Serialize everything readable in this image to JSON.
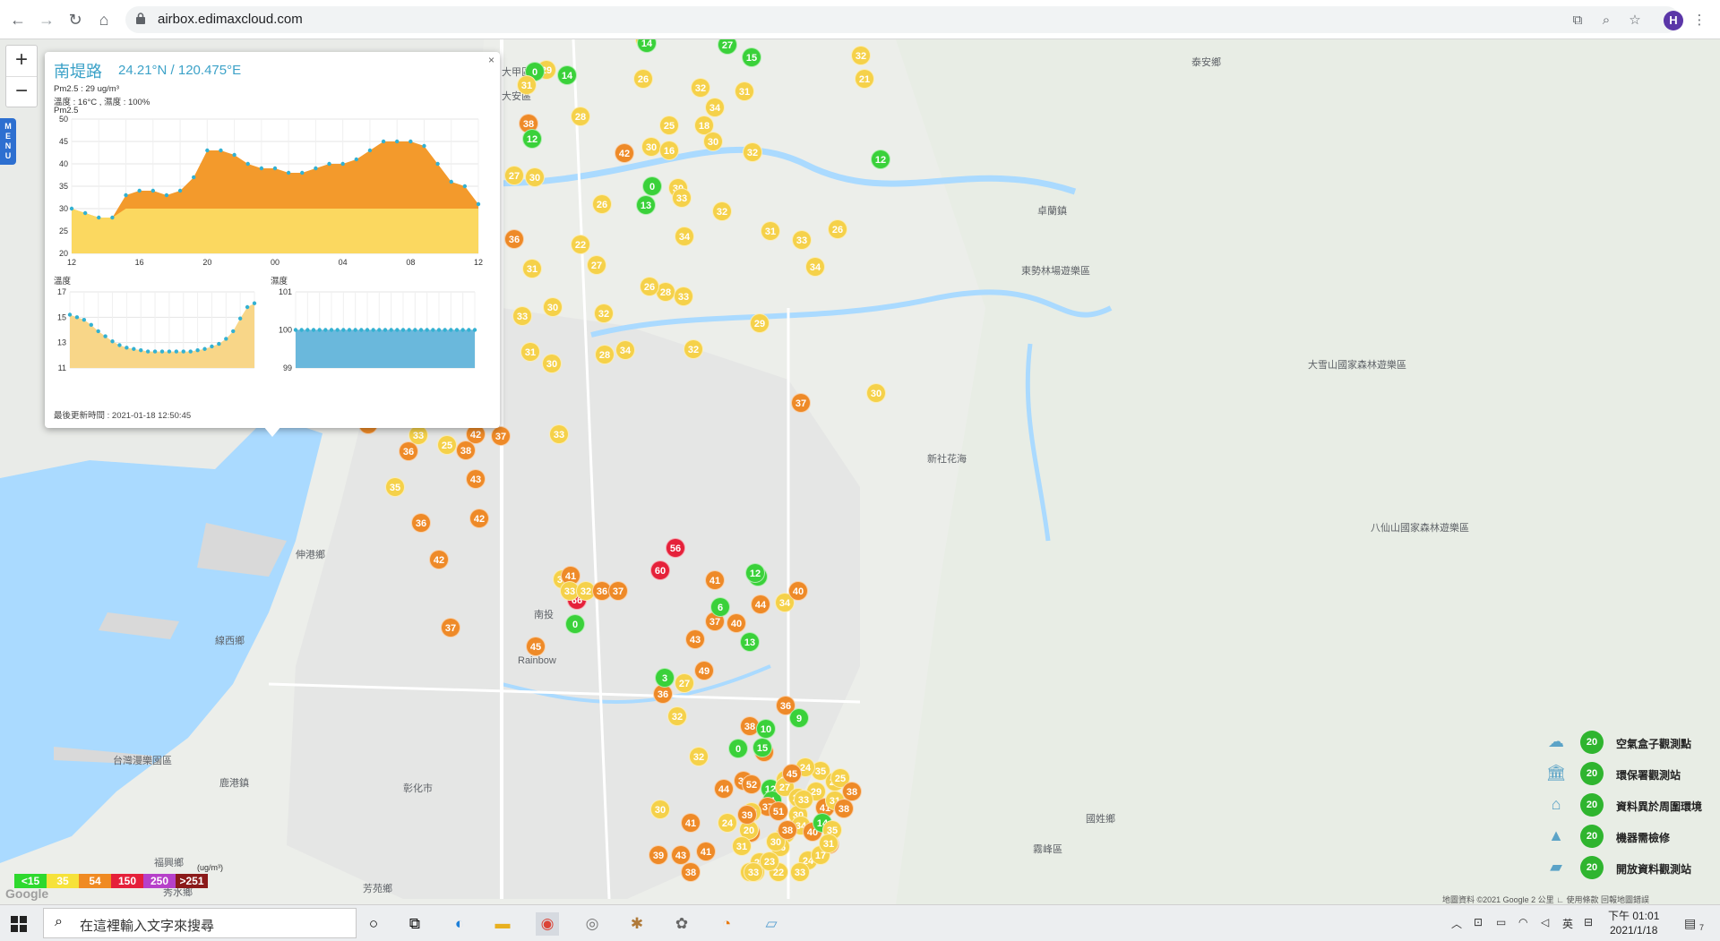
{
  "browser": {
    "url": "airbox.edimaxcloud.com",
    "profile_initial": "H"
  },
  "popup": {
    "close": "×",
    "title": "南堤路",
    "coords": "24.21°N / 120.475°E",
    "pm25_line": "Pm2.5 : 29 ug/m³",
    "temp_humidity_line": "溫度 : 16°C , 濕度 : 100%",
    "chart_title": "Pm2.5",
    "temp_title": "溫度",
    "humidity_title": "濕度",
    "last_update": "最後更新時間 : 2021-01-18 12:50:45"
  },
  "chart_data": [
    {
      "type": "area",
      "title": "Pm2.5",
      "x_ticks": [
        "12",
        "16",
        "20",
        "00",
        "04",
        "08",
        "12"
      ],
      "ylim": [
        20,
        50
      ],
      "y_ticks": [
        20,
        25,
        30,
        35,
        40,
        45,
        50
      ],
      "values": [
        30,
        29,
        28,
        28,
        33,
        34,
        34,
        33,
        34,
        37,
        43,
        43,
        42,
        40,
        39,
        39,
        38,
        38,
        39,
        40,
        40,
        41,
        43,
        45,
        45,
        45,
        44,
        40,
        36,
        35,
        31
      ]
    },
    {
      "type": "area",
      "title": "溫度",
      "ylim": [
        11,
        17
      ],
      "y_ticks": [
        11,
        13,
        15,
        17
      ],
      "values": [
        15.2,
        15,
        14.8,
        14.4,
        13.9,
        13.5,
        13.1,
        12.8,
        12.6,
        12.5,
        12.4,
        12.3,
        12.3,
        12.3,
        12.3,
        12.3,
        12.3,
        12.3,
        12.4,
        12.5,
        12.7,
        12.9,
        13.3,
        13.9,
        14.9,
        15.8,
        16.1
      ]
    },
    {
      "type": "area",
      "title": "濕度",
      "ylim": [
        99,
        101
      ],
      "y_ticks": [
        99,
        100,
        101
      ],
      "values": [
        100,
        100,
        100,
        100,
        100,
        100,
        100,
        100,
        100,
        100,
        100,
        100,
        100,
        100,
        100,
        100,
        100,
        100,
        100,
        100,
        100,
        100,
        100,
        100,
        100,
        100,
        100,
        100,
        100,
        100,
        100
      ]
    }
  ],
  "zoom": {
    "in": "+",
    "out": "−"
  },
  "menu_tab": "MENU",
  "aqi_legend": [
    {
      "label": "<15",
      "color": "#2ed92e"
    },
    {
      "label": "35",
      "color": "#f6e23a"
    },
    {
      "label": "54",
      "color": "#f08a22"
    },
    {
      "label": "150",
      "color": "#e5203a"
    },
    {
      "label": "250",
      "color": "#b640c9"
    },
    {
      "label": ">251",
      "color": "#8b1a1a"
    }
  ],
  "aqi_unit": "(ug/m³)",
  "type_legend": [
    {
      "icon": "cloud-box-icon",
      "badge": "20",
      "label": "空氣盒子觀測點"
    },
    {
      "icon": "government-building-icon",
      "badge": "20",
      "label": "環保署觀測站"
    },
    {
      "icon": "house-warning-icon",
      "badge": "20",
      "label": "資料異於周圍環境"
    },
    {
      "icon": "traffic-cone-icon",
      "badge": "20",
      "label": "機器需檢修"
    },
    {
      "icon": "open-data-icon",
      "badge": "20",
      "label": "開放資料觀測站"
    }
  ],
  "map_labels": [
    {
      "text": "大甲區"
    },
    {
      "text": "大安區"
    },
    {
      "text": "東勢林場遊樂區"
    },
    {
      "text": "大雪山國家森林遊樂區"
    },
    {
      "text": "卓蘭鎮"
    },
    {
      "text": "泰安鄉"
    },
    {
      "text": "伸港鄉"
    },
    {
      "text": "線西鄉"
    },
    {
      "text": "鹿港鎮"
    },
    {
      "text": "彰化市"
    },
    {
      "text": "福興鄉"
    },
    {
      "text": "秀水鄉"
    },
    {
      "text": "芳苑鄉"
    },
    {
      "text": "南投"
    },
    {
      "text": "霧峰區"
    },
    {
      "text": "八仙山國家森林遊樂區"
    },
    {
      "text": "國姓鄉"
    },
    {
      "text": "台灣漫樂園區"
    },
    {
      "text": "新社花海"
    },
    {
      "text": "Rainbow"
    }
  ],
  "markers": [
    {
      "v": "30",
      "c": "y"
    },
    {
      "v": "27",
      "c": "g"
    },
    {
      "v": "32",
      "c": "y"
    },
    {
      "v": "21",
      "c": "y"
    },
    {
      "v": "14",
      "c": "g"
    },
    {
      "v": "15",
      "c": "g"
    },
    {
      "v": "29",
      "c": "y"
    },
    {
      "v": "26",
      "c": "y"
    },
    {
      "v": "32",
      "c": "y"
    },
    {
      "v": "0",
      "c": "g"
    },
    {
      "v": "14",
      "c": "g"
    },
    {
      "v": "14",
      "c": "g"
    },
    {
      "v": "31",
      "c": "y"
    },
    {
      "v": "38",
      "c": "o"
    },
    {
      "v": "28",
      "c": "y"
    },
    {
      "v": "25",
      "c": "y"
    },
    {
      "v": "34",
      "c": "y"
    },
    {
      "v": "32",
      "c": "y"
    },
    {
      "v": "13",
      "c": "g"
    },
    {
      "v": "18",
      "c": "y"
    },
    {
      "v": "42",
      "c": "o"
    },
    {
      "v": "30",
      "c": "y"
    },
    {
      "v": "12",
      "c": "g"
    },
    {
      "v": "14",
      "c": "g"
    },
    {
      "v": "12",
      "c": "g"
    },
    {
      "v": "16",
      "c": "y"
    },
    {
      "v": "31",
      "c": "y"
    },
    {
      "v": "27",
      "c": "y"
    },
    {
      "v": "30",
      "c": "y"
    },
    {
      "v": "0",
      "c": "g"
    },
    {
      "v": "30",
      "c": "y"
    },
    {
      "v": "26",
      "c": "y"
    },
    {
      "v": "30",
      "c": "y"
    },
    {
      "v": "30",
      "c": "y"
    },
    {
      "v": "13",
      "c": "g"
    },
    {
      "v": "33",
      "c": "y"
    },
    {
      "v": "16",
      "c": "y"
    },
    {
      "v": "36",
      "c": "o"
    },
    {
      "v": "22",
      "c": "y"
    },
    {
      "v": "32",
      "c": "y"
    },
    {
      "v": "31",
      "c": "y"
    },
    {
      "v": "26",
      "c": "y"
    },
    {
      "v": "34",
      "c": "y"
    },
    {
      "v": "33",
      "c": "y"
    },
    {
      "v": "31",
      "c": "y"
    },
    {
      "v": "27",
      "c": "y"
    },
    {
      "v": "34",
      "c": "y"
    },
    {
      "v": "28",
      "c": "y"
    },
    {
      "v": "29",
      "c": "y"
    },
    {
      "v": "30",
      "c": "y"
    },
    {
      "v": "32",
      "c": "y"
    },
    {
      "v": "26",
      "c": "y"
    },
    {
      "v": "33",
      "c": "y"
    },
    {
      "v": "28",
      "c": "y"
    },
    {
      "v": "31",
      "c": "y"
    },
    {
      "v": "33",
      "c": "y"
    },
    {
      "v": "32",
      "c": "y"
    },
    {
      "v": "30",
      "c": "y"
    },
    {
      "v": "34",
      "c": "y"
    },
    {
      "v": "30",
      "c": "y"
    },
    {
      "v": "37",
      "c": "o"
    },
    {
      "v": "32",
      "c": "y"
    },
    {
      "v": "36",
      "c": "o"
    },
    {
      "v": "33",
      "c": "y"
    },
    {
      "v": "25",
      "c": "y"
    },
    {
      "v": "41",
      "c": "o"
    },
    {
      "v": "36",
      "c": "o"
    },
    {
      "v": "38",
      "c": "o"
    },
    {
      "v": "42",
      "c": "o"
    },
    {
      "v": "37",
      "c": "o"
    },
    {
      "v": "33",
      "c": "y"
    },
    {
      "v": "35",
      "c": "y"
    },
    {
      "v": "43",
      "c": "o"
    },
    {
      "v": "36",
      "c": "o"
    },
    {
      "v": "42",
      "c": "o"
    },
    {
      "v": "30",
      "c": "y"
    },
    {
      "v": "41",
      "c": "o"
    },
    {
      "v": "45",
      "c": "o"
    },
    {
      "v": "37",
      "c": "o"
    },
    {
      "v": "42",
      "c": "o"
    },
    {
      "v": "0",
      "c": "g"
    },
    {
      "v": "44",
      "c": "o"
    },
    {
      "v": "34",
      "c": "y"
    },
    {
      "v": "41",
      "c": "o"
    },
    {
      "v": "36",
      "c": "o"
    },
    {
      "v": "32",
      "c": "y"
    },
    {
      "v": "66",
      "c": "r"
    },
    {
      "v": "60",
      "c": "r"
    },
    {
      "v": "56",
      "c": "r"
    },
    {
      "v": "5",
      "c": "g"
    },
    {
      "v": "13",
      "c": "g"
    },
    {
      "v": "40",
      "c": "o"
    },
    {
      "v": "37",
      "c": "o"
    },
    {
      "v": "40",
      "c": "o"
    },
    {
      "v": "43",
      "c": "o"
    },
    {
      "v": "49",
      "c": "o"
    },
    {
      "v": "38",
      "c": "o"
    },
    {
      "v": "43",
      "c": "o"
    },
    {
      "v": "37",
      "c": "o"
    },
    {
      "v": "44",
      "c": "o"
    },
    {
      "v": "41",
      "c": "o"
    },
    {
      "v": "39",
      "c": "o"
    },
    {
      "v": "43",
      "c": "o"
    },
    {
      "v": "38",
      "c": "o"
    },
    {
      "v": "41",
      "c": "o"
    },
    {
      "v": "44",
      "c": "o"
    },
    {
      "v": "30",
      "c": "y"
    },
    {
      "v": "32",
      "c": "y"
    },
    {
      "v": "36",
      "c": "o"
    },
    {
      "v": "6",
      "c": "g"
    },
    {
      "v": "12",
      "c": "g"
    },
    {
      "v": "3",
      "c": "g"
    },
    {
      "v": "27",
      "c": "y"
    },
    {
      "v": "9",
      "c": "g"
    },
    {
      "v": "10",
      "c": "g"
    },
    {
      "v": "15",
      "c": "g"
    },
    {
      "v": "0",
      "c": "g"
    },
    {
      "v": "12",
      "c": "g"
    },
    {
      "v": "4",
      "c": "g"
    },
    {
      "v": "28",
      "c": "y"
    },
    {
      "v": "35",
      "c": "y"
    },
    {
      "v": "29",
      "c": "y"
    },
    {
      "v": "37",
      "c": "o"
    },
    {
      "v": "26",
      "c": "y"
    },
    {
      "v": "20",
      "c": "y"
    },
    {
      "v": "24",
      "c": "y"
    },
    {
      "v": "31",
      "c": "y"
    },
    {
      "v": "25",
      "c": "y"
    },
    {
      "v": "34",
      "c": "y"
    },
    {
      "v": "24",
      "c": "y"
    },
    {
      "v": "27",
      "c": "y"
    },
    {
      "v": "29",
      "c": "y"
    },
    {
      "v": "26",
      "c": "y"
    },
    {
      "v": "29",
      "c": "y"
    },
    {
      "v": "30",
      "c": "y"
    },
    {
      "v": "31",
      "c": "y"
    },
    {
      "v": "33",
      "c": "y"
    },
    {
      "v": "25",
      "c": "y"
    },
    {
      "v": "22",
      "c": "y"
    },
    {
      "v": "24",
      "c": "y"
    },
    {
      "v": "33",
      "c": "y"
    },
    {
      "v": "28",
      "c": "y"
    },
    {
      "v": "25",
      "c": "y"
    },
    {
      "v": "39",
      "c": "o"
    },
    {
      "v": "34",
      "c": "y"
    },
    {
      "v": "51",
      "c": "o"
    },
    {
      "v": "45",
      "c": "o"
    },
    {
      "v": "52",
      "c": "o"
    },
    {
      "v": "40",
      "c": "o"
    },
    {
      "v": "41",
      "c": "o"
    },
    {
      "v": "38",
      "c": "o"
    },
    {
      "v": "30",
      "c": "y"
    },
    {
      "v": "33",
      "c": "y"
    },
    {
      "v": "38",
      "c": "o"
    },
    {
      "v": "14",
      "c": "g"
    },
    {
      "v": "23",
      "c": "y"
    },
    {
      "v": "17",
      "c": "y"
    },
    {
      "v": "31",
      "c": "y"
    },
    {
      "v": "38",
      "c": "o"
    },
    {
      "v": "35",
      "c": "y"
    },
    {
      "v": "38",
      "c": "o"
    },
    {
      "v": "31",
      "c": "y"
    },
    {
      "v": "33",
      "c": "y"
    },
    {
      "v": "32",
      "c": "y"
    },
    {
      "v": "36",
      "c": "o"
    },
    {
      "v": "37",
      "c": "o"
    }
  ],
  "copyright": "地圖資料 ©2021 Google   2 公里 ∟   使用條款   回報地圖錯誤",
  "google_logo": "Google",
  "taskbar": {
    "search_placeholder": "在這裡輸入文字來搜尋",
    "time": "下午 01:01",
    "date": "2021/1/18",
    "ime": "英",
    "notification_count": "7"
  }
}
